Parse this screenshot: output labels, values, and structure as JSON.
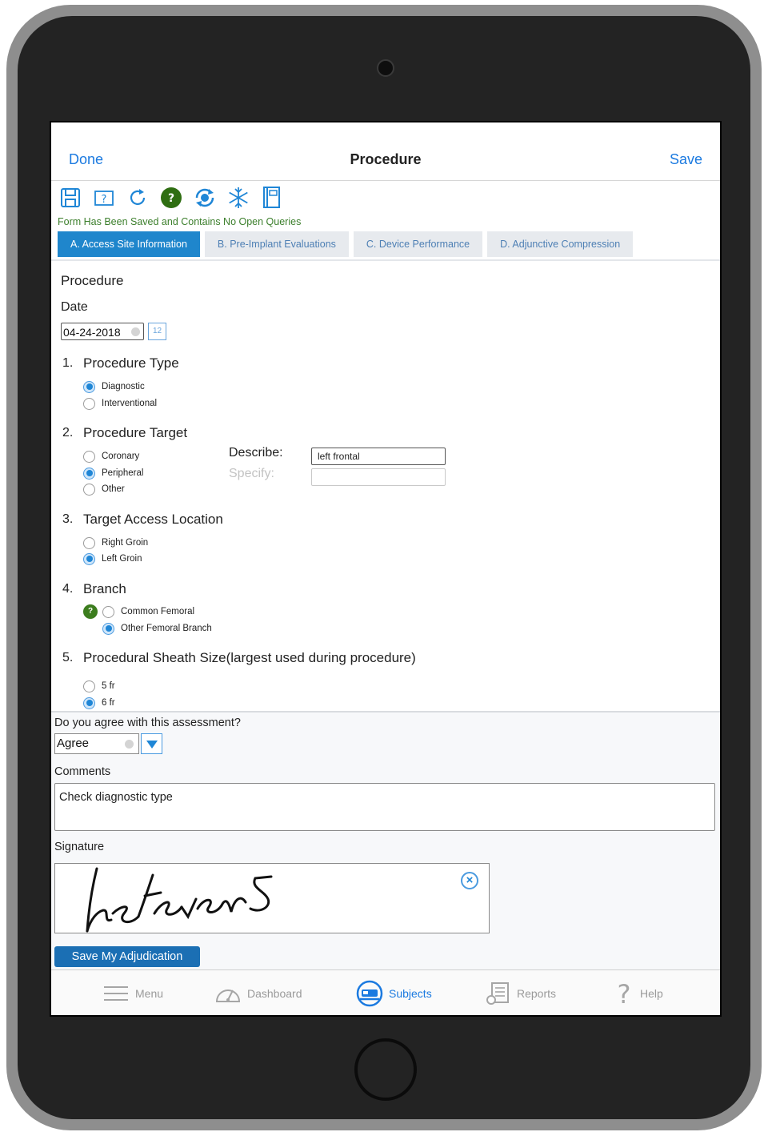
{
  "navbar": {
    "done_label": "Done",
    "title": "Procedure",
    "save_label": "Save"
  },
  "toolbar": {
    "icons": [
      "save-icon",
      "help-box-icon",
      "refresh-icon",
      "query-icon",
      "sync-icon",
      "freeze-icon",
      "book-icon"
    ],
    "query_badge": "?"
  },
  "status_text": "Form Has Been Saved and Contains No Open Queries",
  "tabs": [
    {
      "label": "A. Access Site Information",
      "active": true
    },
    {
      "label": "B. Pre-Implant Evaluations",
      "active": false
    },
    {
      "label": "C. Device Performance",
      "active": false
    },
    {
      "label": "D. Adjunctive Compression",
      "active": false
    }
  ],
  "form": {
    "title": "Procedure",
    "date_label": "Date",
    "date_value": "04-24-2018",
    "calendar_day": "12",
    "questions": [
      {
        "number": "1.",
        "text": "Procedure Type",
        "options": [
          {
            "label": "Diagnostic",
            "selected": true
          },
          {
            "label": "Interventional",
            "selected": false
          }
        ]
      },
      {
        "number": "2.",
        "text": "Procedure Target",
        "options": [
          {
            "label": "Coronary",
            "selected": false
          },
          {
            "label": "Peripheral",
            "selected": true
          },
          {
            "label": "Other",
            "selected": false
          }
        ],
        "describe_label": "Describe:",
        "describe_value": "left frontal",
        "specify_label": "Specify:",
        "specify_value": ""
      },
      {
        "number": "3.",
        "text": "Target Access Location",
        "options": [
          {
            "label": "Right Groin",
            "selected": false
          },
          {
            "label": "Left Groin",
            "selected": true
          }
        ]
      },
      {
        "number": "4.",
        "text": "Branch",
        "badge": "?",
        "options": [
          {
            "label": "Common Femoral",
            "selected": false
          },
          {
            "label": "Other Femoral Branch",
            "selected": true
          }
        ]
      },
      {
        "number": "5.",
        "text": "Procedural Sheath Size(largest used during procedure)",
        "options": [
          {
            "label": "5 fr",
            "selected": false
          },
          {
            "label": "6 fr",
            "selected": true
          }
        ]
      }
    ]
  },
  "adjudication": {
    "question": "Do you agree with this assessment?",
    "agree_value": "Agree",
    "comments_label": "Comments",
    "comments_value": "Check diagnostic type",
    "signature_label": "Signature",
    "signature_text": "lrstevens",
    "clear_glyph": "×",
    "save_button": "Save My Adjudication"
  },
  "tabbar": [
    {
      "label": "Menu",
      "icon": "menu-icon",
      "active": false
    },
    {
      "label": "Dashboard",
      "icon": "dashboard-icon",
      "active": false
    },
    {
      "label": "Subjects",
      "icon": "subjects-icon",
      "active": true
    },
    {
      "label": "Reports",
      "icon": "reports-icon",
      "active": false
    },
    {
      "label": "Help",
      "icon": "help-icon",
      "active": false
    }
  ],
  "colors": {
    "accent": "#1b7ae0",
    "tab_active": "#1f86cc",
    "status_green": "#3c7f2c",
    "badge_green": "#3c7d1e",
    "device": "#232323"
  }
}
